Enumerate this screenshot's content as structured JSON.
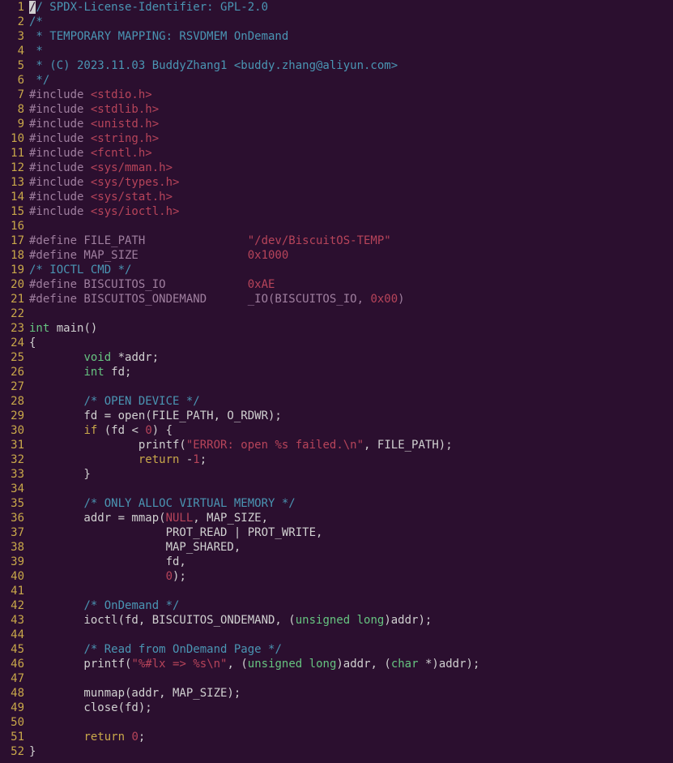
{
  "lines": [
    [
      {
        "t": "// SPDX-License-Identifier: GPL-2.0",
        "c": "c-comment",
        "cursor0": true
      }
    ],
    [
      {
        "t": "/*",
        "c": "c-comment"
      }
    ],
    [
      {
        "t": " * TEMPORARY MAPPING: RSVDMEM OnDemand",
        "c": "c-comment"
      }
    ],
    [
      {
        "t": " *",
        "c": "c-comment"
      }
    ],
    [
      {
        "t": " * (C) 2023.11.03 BuddyZhang1 <buddy.zhang@aliyun.com>",
        "c": "c-comment"
      }
    ],
    [
      {
        "t": " */",
        "c": "c-comment"
      }
    ],
    [
      {
        "t": "#include ",
        "c": "c-preproc"
      },
      {
        "t": "<stdio.h>",
        "c": "c-include"
      }
    ],
    [
      {
        "t": "#include ",
        "c": "c-preproc"
      },
      {
        "t": "<stdlib.h>",
        "c": "c-include"
      }
    ],
    [
      {
        "t": "#include ",
        "c": "c-preproc"
      },
      {
        "t": "<unistd.h>",
        "c": "c-include"
      }
    ],
    [
      {
        "t": "#include ",
        "c": "c-preproc"
      },
      {
        "t": "<string.h>",
        "c": "c-include"
      }
    ],
    [
      {
        "t": "#include ",
        "c": "c-preproc"
      },
      {
        "t": "<fcntl.h>",
        "c": "c-include"
      }
    ],
    [
      {
        "t": "#include ",
        "c": "c-preproc"
      },
      {
        "t": "<sys/mman.h>",
        "c": "c-include"
      }
    ],
    [
      {
        "t": "#include ",
        "c": "c-preproc"
      },
      {
        "t": "<sys/types.h>",
        "c": "c-include"
      }
    ],
    [
      {
        "t": "#include ",
        "c": "c-preproc"
      },
      {
        "t": "<sys/stat.h>",
        "c": "c-include"
      }
    ],
    [
      {
        "t": "#include ",
        "c": "c-preproc"
      },
      {
        "t": "<sys/ioctl.h>",
        "c": "c-include"
      }
    ],
    [
      {
        "t": "",
        "c": "c-default"
      }
    ],
    [
      {
        "t": "#define FILE_PATH               ",
        "c": "c-preproc"
      },
      {
        "t": "\"/dev/BiscuitOS-TEMP\"",
        "c": "c-string"
      }
    ],
    [
      {
        "t": "#define MAP_SIZE                ",
        "c": "c-preproc"
      },
      {
        "t": "0x1000",
        "c": "c-number"
      }
    ],
    [
      {
        "t": "/* IOCTL CMD */",
        "c": "c-comment"
      }
    ],
    [
      {
        "t": "#define BISCUITOS_IO            ",
        "c": "c-preproc"
      },
      {
        "t": "0xAE",
        "c": "c-number"
      }
    ],
    [
      {
        "t": "#define BISCUITOS_ONDEMAND      _IO(BISCUITOS_IO, ",
        "c": "c-preproc"
      },
      {
        "t": "0x00",
        "c": "c-number"
      },
      {
        "t": ")",
        "c": "c-preproc"
      }
    ],
    [
      {
        "t": "",
        "c": "c-default"
      }
    ],
    [
      {
        "t": "int",
        "c": "c-type"
      },
      {
        "t": " main()",
        "c": "c-default"
      }
    ],
    [
      {
        "t": "{",
        "c": "c-default"
      }
    ],
    [
      {
        "t": "        ",
        "c": "c-default"
      },
      {
        "t": "void",
        "c": "c-type"
      },
      {
        "t": " *addr;",
        "c": "c-default"
      }
    ],
    [
      {
        "t": "        ",
        "c": "c-default"
      },
      {
        "t": "int",
        "c": "c-type"
      },
      {
        "t": " fd;",
        "c": "c-default"
      }
    ],
    [
      {
        "t": "",
        "c": "c-default"
      }
    ],
    [
      {
        "t": "        ",
        "c": "c-default"
      },
      {
        "t": "/* OPEN DEVICE */",
        "c": "c-comment"
      }
    ],
    [
      {
        "t": "        fd = open(FILE_PATH, O_RDWR);",
        "c": "c-default"
      }
    ],
    [
      {
        "t": "        ",
        "c": "c-default"
      },
      {
        "t": "if",
        "c": "c-keyword"
      },
      {
        "t": " (fd < ",
        "c": "c-default"
      },
      {
        "t": "0",
        "c": "c-number"
      },
      {
        "t": ") {",
        "c": "c-default"
      }
    ],
    [
      {
        "t": "                printf(",
        "c": "c-default"
      },
      {
        "t": "\"ERROR: open ",
        "c": "c-string"
      },
      {
        "t": "%s",
        "c": "c-op"
      },
      {
        "t": " failed.",
        "c": "c-string"
      },
      {
        "t": "\\n",
        "c": "c-op"
      },
      {
        "t": "\"",
        "c": "c-string"
      },
      {
        "t": ", FILE_PATH);",
        "c": "c-default"
      }
    ],
    [
      {
        "t": "                ",
        "c": "c-default"
      },
      {
        "t": "return",
        "c": "c-keyword"
      },
      {
        "t": " -",
        "c": "c-default"
      },
      {
        "t": "1",
        "c": "c-number"
      },
      {
        "t": ";",
        "c": "c-default"
      }
    ],
    [
      {
        "t": "        }",
        "c": "c-default"
      }
    ],
    [
      {
        "t": "",
        "c": "c-default"
      }
    ],
    [
      {
        "t": "        ",
        "c": "c-default"
      },
      {
        "t": "/* ONLY ALLOC VIRTUAL MEMORY */",
        "c": "c-comment"
      }
    ],
    [
      {
        "t": "        addr = mmap(",
        "c": "c-default"
      },
      {
        "t": "NULL",
        "c": "c-number"
      },
      {
        "t": ", MAP_SIZE,",
        "c": "c-default"
      }
    ],
    [
      {
        "t": "                    PROT_READ | PROT_WRITE,",
        "c": "c-default"
      }
    ],
    [
      {
        "t": "                    MAP_SHARED,",
        "c": "c-default"
      }
    ],
    [
      {
        "t": "                    fd,",
        "c": "c-default"
      }
    ],
    [
      {
        "t": "                    ",
        "c": "c-default"
      },
      {
        "t": "0",
        "c": "c-number"
      },
      {
        "t": ");",
        "c": "c-default"
      }
    ],
    [
      {
        "t": "",
        "c": "c-default"
      }
    ],
    [
      {
        "t": "        ",
        "c": "c-default"
      },
      {
        "t": "/* OnDemand */",
        "c": "c-comment"
      }
    ],
    [
      {
        "t": "        ioctl(fd, BISCUITOS_ONDEMAND, (",
        "c": "c-default"
      },
      {
        "t": "unsigned",
        "c": "c-type"
      },
      {
        "t": " ",
        "c": "c-default"
      },
      {
        "t": "long",
        "c": "c-type"
      },
      {
        "t": ")addr);",
        "c": "c-default"
      }
    ],
    [
      {
        "t": "",
        "c": "c-default"
      }
    ],
    [
      {
        "t": "        ",
        "c": "c-default"
      },
      {
        "t": "/* Read from OnDemand Page */",
        "c": "c-comment"
      }
    ],
    [
      {
        "t": "        printf(",
        "c": "c-default"
      },
      {
        "t": "\"",
        "c": "c-string"
      },
      {
        "t": "%#lx",
        "c": "c-op"
      },
      {
        "t": " ",
        "c": "c-string"
      },
      {
        "t": "=>",
        "c": "c-op"
      },
      {
        "t": " ",
        "c": "c-string"
      },
      {
        "t": "%s",
        "c": "c-op"
      },
      {
        "t": "\\n",
        "c": "c-op"
      },
      {
        "t": "\"",
        "c": "c-string"
      },
      {
        "t": ", (",
        "c": "c-default"
      },
      {
        "t": "unsigned",
        "c": "c-type"
      },
      {
        "t": " ",
        "c": "c-default"
      },
      {
        "t": "long",
        "c": "c-type"
      },
      {
        "t": ")addr, (",
        "c": "c-default"
      },
      {
        "t": "char",
        "c": "c-type"
      },
      {
        "t": " *)addr);",
        "c": "c-default"
      }
    ],
    [
      {
        "t": "",
        "c": "c-default"
      }
    ],
    [
      {
        "t": "        munmap(addr, MAP_SIZE);",
        "c": "c-default"
      }
    ],
    [
      {
        "t": "        close(fd);",
        "c": "c-default"
      }
    ],
    [
      {
        "t": "",
        "c": "c-default"
      }
    ],
    [
      {
        "t": "        ",
        "c": "c-default"
      },
      {
        "t": "return",
        "c": "c-keyword"
      },
      {
        "t": " ",
        "c": "c-default"
      },
      {
        "t": "0",
        "c": "c-number"
      },
      {
        "t": ";",
        "c": "c-default"
      }
    ],
    [
      {
        "t": "}",
        "c": "c-default"
      }
    ]
  ]
}
